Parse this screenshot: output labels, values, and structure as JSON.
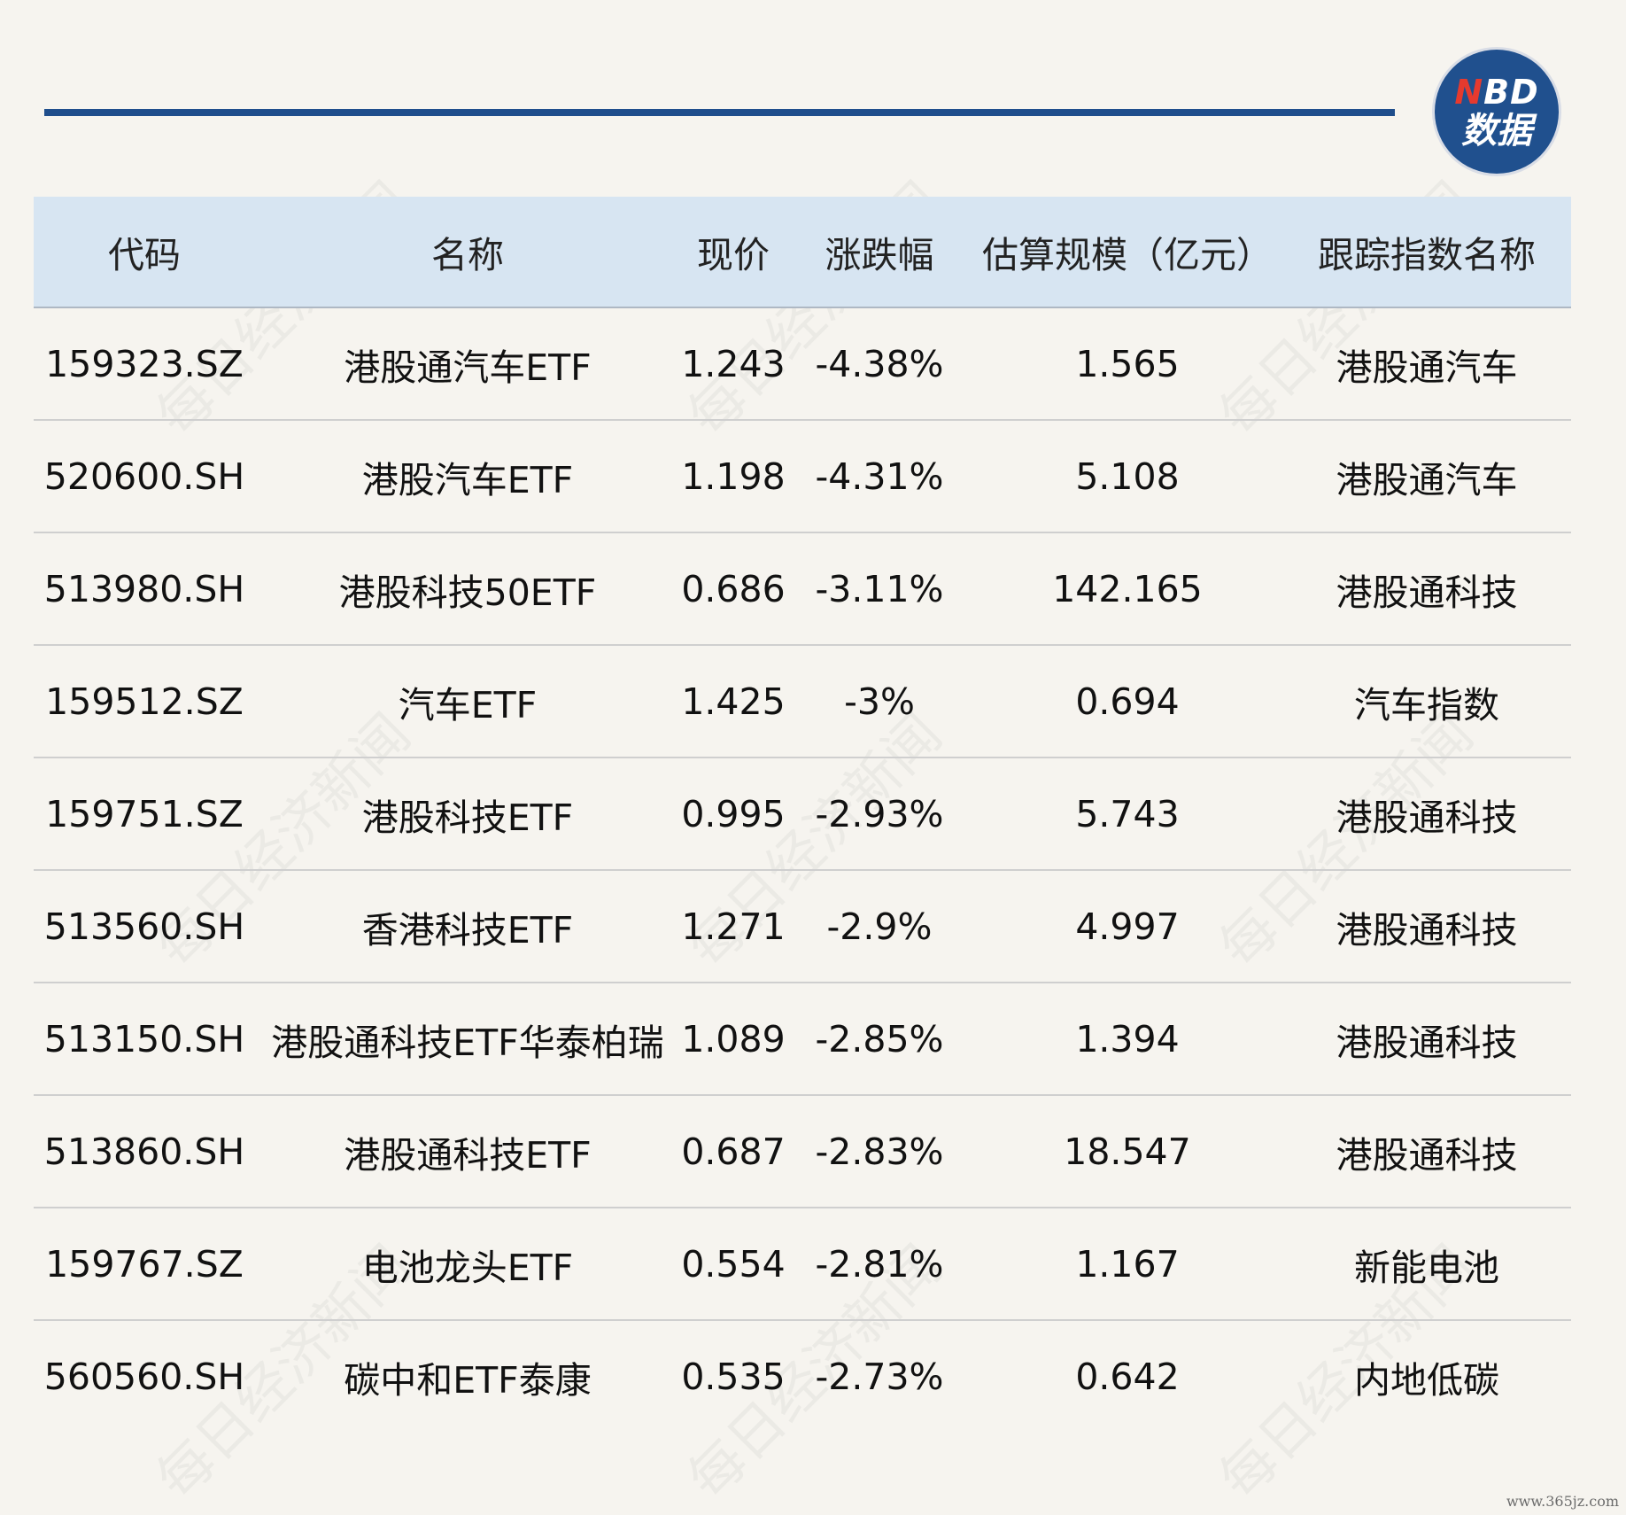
{
  "logo": {
    "line1_n": "N",
    "line1_rest": "BD",
    "line2": "数据"
  },
  "table": {
    "headers": [
      "代码",
      "名称",
      "现价",
      "涨跌幅",
      "估算规模（亿元）",
      "跟踪指数名称"
    ],
    "rows": [
      [
        "159323.SZ",
        "港股通汽车ETF",
        "1.243",
        "-4.38%",
        "1.565",
        "港股通汽车"
      ],
      [
        "520600.SH",
        "港股汽车ETF",
        "1.198",
        "-4.31%",
        "5.108",
        "港股通汽车"
      ],
      [
        "513980.SH",
        "港股科技50ETF",
        "0.686",
        "-3.11%",
        "142.165",
        "港股通科技"
      ],
      [
        "159512.SZ",
        "汽车ETF",
        "1.425",
        "-3%",
        "0.694",
        "汽车指数"
      ],
      [
        "159751.SZ",
        "港股科技ETF",
        "0.995",
        "-2.93%",
        "5.743",
        "港股通科技"
      ],
      [
        "513560.SH",
        "香港科技ETF",
        "1.271",
        "-2.9%",
        "4.997",
        "港股通科技"
      ],
      [
        "513150.SH",
        "港股通科技ETF华泰柏瑞",
        "1.089",
        "-2.85%",
        "1.394",
        "港股通科技"
      ],
      [
        "513860.SH",
        "港股通科技ETF",
        "0.687",
        "-2.83%",
        "18.547",
        "港股通科技"
      ],
      [
        "159767.SZ",
        "电池龙头ETF",
        "0.554",
        "-2.81%",
        "1.167",
        "新能电池"
      ],
      [
        "560560.SH",
        "碳中和ETF泰康",
        "0.535",
        "-2.73%",
        "0.642",
        "内地低碳"
      ]
    ]
  },
  "watermark": "每日经济新闻",
  "footer": {
    "site": "www.365jz.com"
  }
}
